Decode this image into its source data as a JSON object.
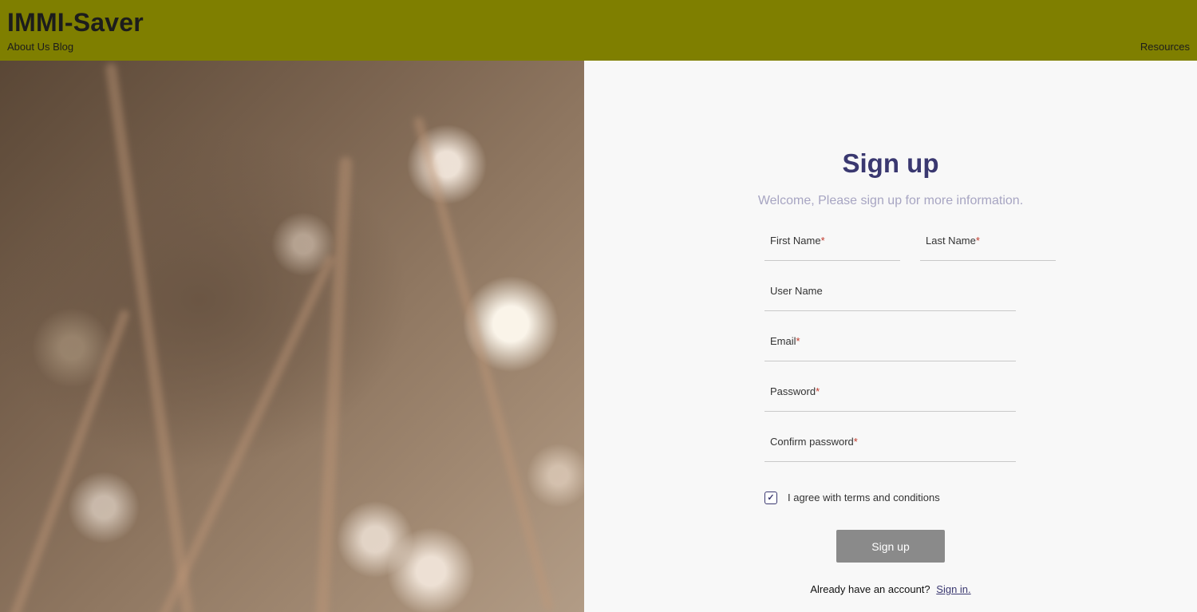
{
  "header": {
    "brand": "IMMI-Saver",
    "nav_left": [
      "About Us",
      "Blog"
    ],
    "nav_right": "Resources"
  },
  "form": {
    "title": "Sign up",
    "subtitle": "Welcome, Please sign up for more information.",
    "fields": {
      "first_name": {
        "label": "First Name",
        "required_mark": "*"
      },
      "last_name": {
        "label": "Last Name",
        "required_mark": "*"
      },
      "user_name": {
        "label": "User Name",
        "required_mark": ""
      },
      "email": {
        "label": "Email",
        "required_mark": "*"
      },
      "password": {
        "label": "Password",
        "required_mark": "*"
      },
      "confirm_password": {
        "label": "Confirm password",
        "required_mark": "*"
      }
    },
    "agree_label": "I agree with terms and conditions",
    "agree_checked": true,
    "agree_check_glyph": "✓",
    "submit_label": "Sign up",
    "signin_prompt": "Already have an account?",
    "signin_link": "Sign in."
  },
  "colors": {
    "header_bg": "#7f7f00",
    "title": "#3a3870",
    "button_bg": "#8a8a8a",
    "required": "#c0392b"
  }
}
